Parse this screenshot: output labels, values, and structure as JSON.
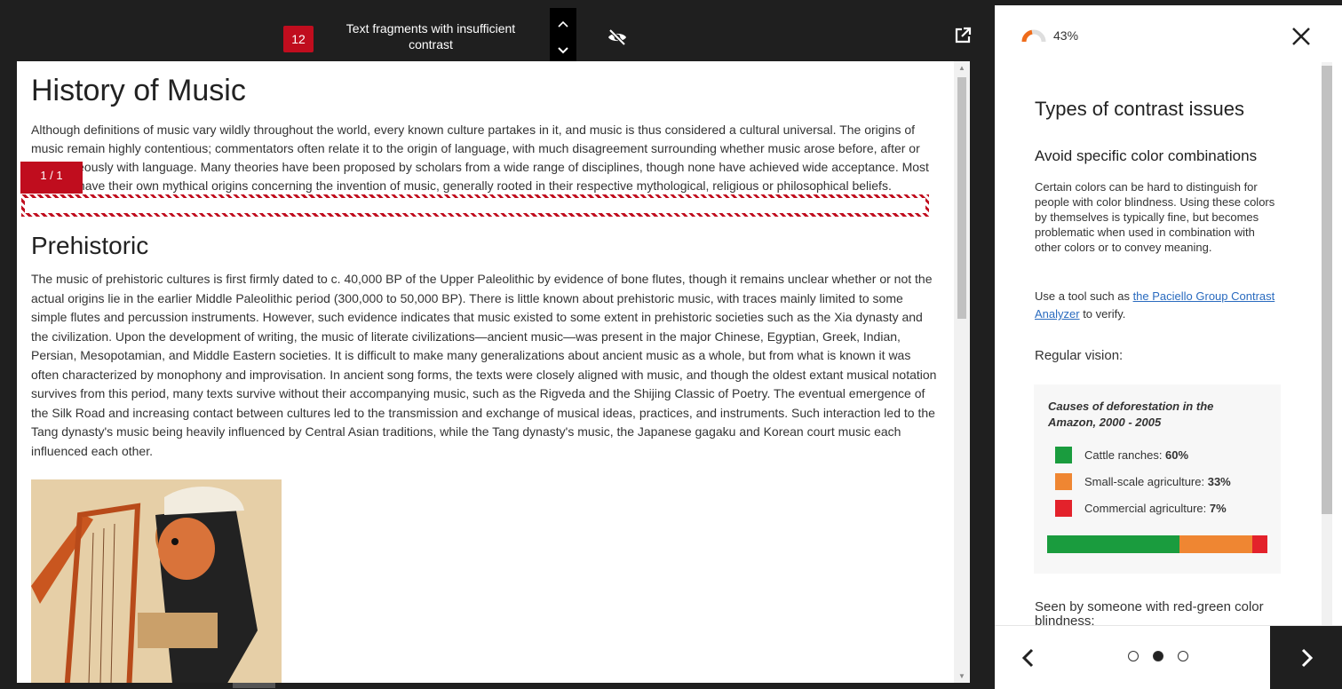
{
  "toolbar": {
    "issue_count": "12",
    "label": "Text fragments with insufficient contrast"
  },
  "content": {
    "title": "History of Music",
    "intro": "Although definitions of music vary wildly throughout the world, every known culture partakes in it, and music is thus considered a cultural universal. The origins of music remain highly contentious; commentators often relate it to the origin of language, with much disagreement surrounding whether music arose before, after or simultaneously with language. Many theories have been proposed by scholars from a wide range of disciplines, though none have achieved wide acceptance. Most cultures have their own mythical origins concerning the invention of music, generally rooted in their respective mythological, religious or philosophical beliefs.",
    "issue_tag": "1 / 1",
    "section_title": "Prehistoric",
    "section_body": "The music of prehistoric cultures is first firmly dated to c. 40,000 BP of the Upper Paleolithic by evidence of bone flutes, though it remains unclear whether or not the actual origins lie in the earlier Middle Paleolithic period (300,000 to 50,000 BP). There is little known about prehistoric music, with traces mainly limited to some simple flutes and percussion instruments. However, such evidence indicates that music existed to some extent in prehistoric societies such as the Xia dynasty and the civilization. Upon the development of writing, the music of literate civilizations—ancient music—was present in the major Chinese, Egyptian, Greek, Indian, Persian, Mesopotamian, and Middle Eastern societies. It is difficult to make many generalizations about ancient music as a whole, but from what is known it was often characterized by monophony and improvisation. In ancient song forms, the texts were closely aligned with music, and though the oldest extant musical notation survives from this period, many texts survive without their accompanying music, such as the Rigveda and the Shijing Classic of Poetry. The eventual emergence of the Silk Road and increasing contact between cultures led to the transmission and exchange of musical ideas, practices, and instruments. Such interaction led to the Tang dynasty's music being heavily influenced by Central Asian traditions, while the Tang dynasty's music, the Japanese gagaku and Korean court music each influenced each other."
  },
  "panel": {
    "progress": "43%",
    "progress_value": 0.43,
    "title": "Types of contrast issues",
    "subtitle": "Avoid specific color combinations",
    "body": "Certain colors can be hard to distinguish for people with color blindness. Using these colors by themselves is typically fine, but becomes problematic when used in combination with other colors or to convey meaning.",
    "tool_prefix": "Use a tool such as ",
    "tool_link": "the Paciello Group Contrast Analyzer",
    "tool_suffix": " to verify.",
    "regular_vision": "Regular vision:",
    "card_title": "Causes of deforestation in the Amazon, 2000 - 2005",
    "legend": [
      {
        "label": "Cattle ranches: ",
        "value": "60%",
        "color": "#1a9c3e",
        "share": 60
      },
      {
        "label": "Small-scale agriculture: ",
        "value": "33%",
        "color": "#ef8632",
        "share": 33
      },
      {
        "label": "Commercial agriculture: ",
        "value": "7%",
        "color": "#e3222b",
        "share": 7
      }
    ],
    "seen_by": "Seen by someone with red-green color blindness:",
    "pager": {
      "total": 3,
      "active": 1
    }
  }
}
